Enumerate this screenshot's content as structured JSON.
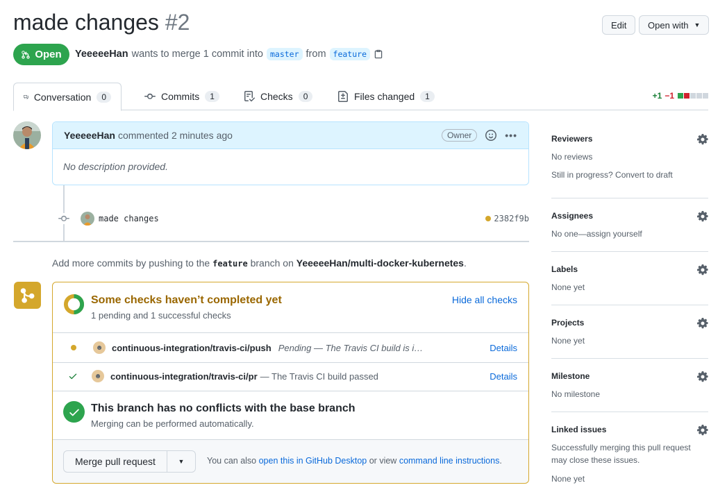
{
  "header": {
    "title": "made changes",
    "number": "#2",
    "edit_label": "Edit",
    "open_with_label": "Open with"
  },
  "state": {
    "badge_label": "Open",
    "author": "YeeeeeHan",
    "action_text": "wants to merge 1 commit into",
    "base_branch": "master",
    "from_text": "from",
    "head_branch": "feature",
    "badge_color": "#2da44e"
  },
  "tabs": [
    {
      "label": "Conversation",
      "count": "0"
    },
    {
      "label": "Commits",
      "count": "1"
    },
    {
      "label": "Checks",
      "count": "0"
    },
    {
      "label": "Files changed",
      "count": "1"
    }
  ],
  "diffstat": {
    "additions": "+1",
    "deletions": "−1"
  },
  "comment": {
    "author": "YeeeeeHan",
    "action": "commented 2 minutes ago",
    "role_badge": "Owner",
    "body": "No description provided."
  },
  "commit": {
    "message": "made changes",
    "sha": "2382f9b",
    "status_color": "#d4a72c"
  },
  "push_hint": {
    "prefix": "Add more commits by pushing to the",
    "branch": "feature",
    "middle": "branch on",
    "repo": "YeeeeeHan/multi-docker-kubernetes",
    "suffix": "."
  },
  "checks": {
    "title": "Some checks haven’t completed yet",
    "subtitle": "1 pending and 1 successful checks",
    "hide_label": "Hide all checks",
    "title_color": "#9a6700",
    "items": [
      {
        "name": "continuous-integration/travis-ci/push",
        "description": "Pending — The Travis CI build is i…",
        "status": "pending",
        "details": "Details"
      },
      {
        "name": "continuous-integration/travis-ci/pr",
        "description": "— The Travis CI build passed",
        "status": "success",
        "details": "Details"
      }
    ]
  },
  "conflicts": {
    "title": "This branch has no conflicts with the base branch",
    "subtitle": "Merging can be performed automatically."
  },
  "merge": {
    "button_label": "Merge pull request",
    "hint_prefix": "You can also",
    "desktop_link": "open this in GitHub Desktop",
    "hint_middle": "or view",
    "cli_link": "command line instructions",
    "hint_suffix": "."
  },
  "sidebar": {
    "reviewers": {
      "title": "Reviewers",
      "line1": "No reviews",
      "line2": "Still in progress? Convert to draft"
    },
    "assignees": {
      "title": "Assignees",
      "line1": "No one—assign yourself"
    },
    "labels": {
      "title": "Labels",
      "line1": "None yet"
    },
    "projects": {
      "title": "Projects",
      "line1": "None yet"
    },
    "milestone": {
      "title": "Milestone",
      "line1": "No milestone"
    },
    "linked_issues": {
      "title": "Linked issues",
      "line1": "Successfully merging this pull request may close these issues.",
      "line2": "None yet"
    }
  }
}
